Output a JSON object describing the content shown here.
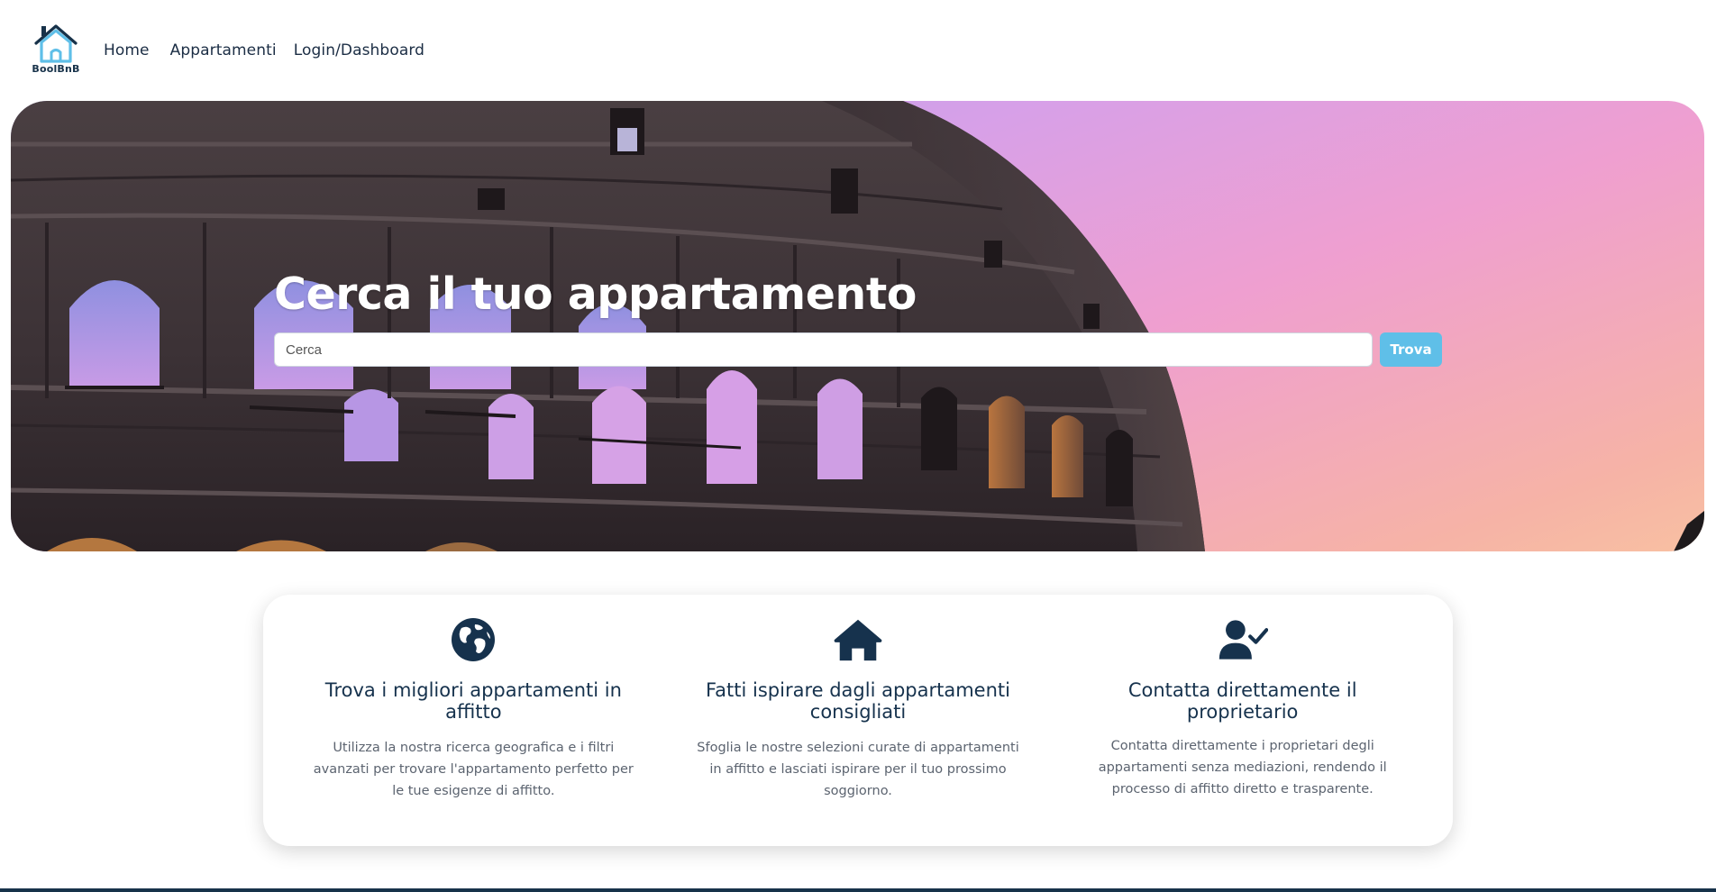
{
  "brand": {
    "logo_text": "BoolBnB",
    "accent_color": "#5fbfe8",
    "dark_color": "#16324d"
  },
  "nav": {
    "items": [
      {
        "label": "Home"
      },
      {
        "label": "Appartamenti"
      },
      {
        "label": "Login/Dashboard"
      }
    ]
  },
  "hero": {
    "title": "Cerca il tuo appartamento",
    "search": {
      "placeholder": "Cerca",
      "value": ""
    },
    "button_label": "Trova"
  },
  "features": [
    {
      "icon": "globe-icon",
      "title": "Trova i migliori appartamenti in affitto",
      "description": "Utilizza la nostra ricerca geografica e i filtri avanzati per trovare l'appartamento perfetto per le tue esigenze di affitto."
    },
    {
      "icon": "house-icon",
      "title": "Fatti ispirare dagli appartamenti consigliati",
      "description": "Sfoglia le nostre selezioni curate di appartamenti in affitto e lasciati ispirare per il tuo prossimo soggiorno."
    },
    {
      "icon": "user-check-icon",
      "title": "Contatta direttamente il proprietario",
      "description": "Contatta direttamente i proprietari degli appartamenti senza mediazioni, rendendo il processo di affitto diretto e trasparente."
    }
  ]
}
